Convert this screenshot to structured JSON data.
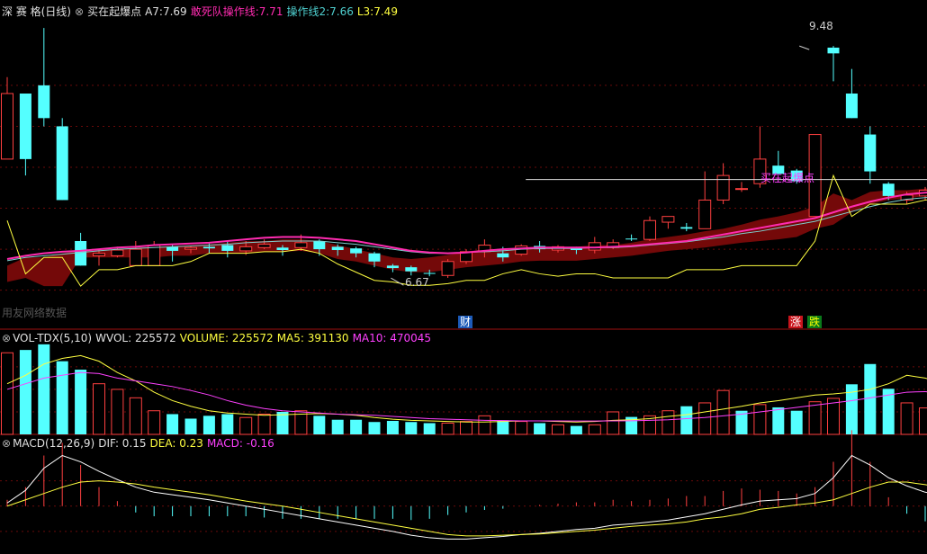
{
  "main_legend": {
    "stock": "深 赛 格(日线)",
    "sep_icon": "⊗",
    "indicator": "买在起爆点",
    "a7_label": "A7:",
    "a7_value": "7.69",
    "line1_label": "敢死队操作线:",
    "line1_value": "7.71",
    "line2_label": "操作线2:",
    "line2_value": "7.66",
    "l3_label": "L3:",
    "l3_value": "7.49"
  },
  "vol_legend": {
    "name": "VOL-TDX(5,10)",
    "wvol": "WVOL: 225572",
    "volume": "VOLUME: 225572",
    "ma5": "MA5: 391130",
    "ma10": "MA10: 470045"
  },
  "macd_legend": {
    "name": "MACD(12,26,9)",
    "dif": "DIF: 0.15",
    "dea": "DEA: 0.23",
    "macd": "MACD: -0.16"
  },
  "annotations": {
    "high_label": "9.48",
    "low_label": "6.67",
    "signal_label": "买在起爆点",
    "event_cai": "财",
    "event_zhang": "涨",
    "event_die": "跌",
    "faded_text": "用友网络数据"
  },
  "colors": {
    "up": "#ff4040",
    "down": "#54ffff",
    "band": "#7a0a0a",
    "yellow": "#ffff40",
    "magenta": "#ff2bb0",
    "ma_line": "#7fd0d0",
    "white": "#ffffff"
  },
  "chart_data": [
    {
      "type": "candlestick",
      "ylim": [
        6.2,
        9.8
      ],
      "signal_level": 7.85,
      "candles": [
        [
          8.1,
          8.9,
          8.1,
          9.1
        ],
        [
          8.9,
          8.1,
          7.9,
          8.9
        ],
        [
          9.0,
          8.6,
          8.5,
          9.7
        ],
        [
          8.5,
          7.6,
          7.6,
          8.6
        ],
        [
          7.1,
          6.8,
          6.8,
          7.2
        ],
        [
          6.92,
          6.95,
          6.8,
          7.0
        ],
        [
          6.92,
          6.99,
          6.9,
          7.03
        ],
        [
          6.8,
          7.0,
          6.8,
          7.1
        ],
        [
          6.8,
          7.05,
          6.85,
          7.1
        ],
        [
          7.03,
          6.98,
          6.85,
          7.05
        ],
        [
          7.0,
          7.02,
          6.95,
          7.04
        ],
        [
          7.03,
          7.01,
          6.95,
          7.08
        ],
        [
          7.05,
          6.98,
          6.9,
          7.1
        ],
        [
          6.98,
          7.03,
          6.93,
          7.1
        ],
        [
          7.02,
          7.06,
          7.0,
          7.12
        ],
        [
          7.02,
          6.99,
          6.92,
          7.05
        ],
        [
          7.02,
          7.08,
          6.98,
          7.18
        ],
        [
          7.1,
          7.0,
          6.92,
          7.12
        ],
        [
          7.03,
          6.99,
          6.92,
          7.06
        ],
        [
          7.01,
          6.95,
          6.9,
          7.03
        ],
        [
          6.95,
          6.85,
          6.78,
          6.97
        ],
        [
          6.8,
          6.77,
          6.72,
          6.82
        ],
        [
          6.78,
          6.73,
          6.68,
          6.8
        ],
        [
          6.71,
          6.7,
          6.67,
          6.75
        ],
        [
          6.68,
          6.85,
          6.65,
          6.88
        ],
        [
          6.85,
          6.97,
          6.82,
          7.0
        ],
        [
          6.97,
          7.05,
          6.9,
          7.12
        ],
        [
          6.95,
          6.9,
          6.85,
          7.03
        ],
        [
          6.94,
          7.04,
          6.92,
          7.06
        ],
        [
          7.04,
          7.0,
          6.96,
          7.1
        ],
        [
          6.99,
          7.03,
          6.96,
          7.05
        ],
        [
          7.01,
          6.99,
          6.94,
          7.03
        ],
        [
          6.99,
          7.08,
          6.95,
          7.15
        ],
        [
          7.02,
          7.08,
          7.0,
          7.12
        ],
        [
          7.13,
          7.12,
          7.1,
          7.18
        ],
        [
          7.12,
          7.35,
          7.1,
          7.4
        ],
        [
          7.33,
          7.4,
          7.25,
          7.4
        ],
        [
          7.27,
          7.25,
          7.22,
          7.32
        ],
        [
          7.25,
          7.6,
          7.25,
          7.95
        ],
        [
          7.6,
          7.9,
          7.55,
          8.05
        ],
        [
          7.74,
          7.74,
          7.7,
          7.82
        ],
        [
          7.8,
          8.1,
          7.75,
          8.5
        ],
        [
          8.02,
          7.92,
          7.92,
          8.2
        ],
        [
          7.96,
          7.83,
          7.8,
          7.98
        ],
        [
          7.4,
          8.4,
          7.4,
          8.4
        ],
        [
          9.46,
          9.39,
          9.05,
          9.48
        ],
        [
          8.9,
          8.6,
          8.6,
          9.2
        ],
        [
          8.4,
          7.95,
          7.8,
          8.5
        ],
        [
          7.8,
          7.65,
          7.6,
          7.82
        ],
        [
          7.6,
          7.66,
          7.55,
          7.7
        ],
        [
          7.65,
          7.72,
          7.6,
          7.76
        ],
        [
          7.7,
          7.74,
          7.65,
          7.79
        ],
        [
          7.7,
          7.71,
          7.67,
          7.75
        ]
      ],
      "a7_line": [
        7.35,
        6.7,
        6.9,
        6.9,
        6.55,
        6.75,
        6.75,
        6.8,
        6.8,
        6.8,
        6.85,
        6.95,
        6.95,
        6.95,
        6.97,
        6.97,
        7.0,
        6.95,
        6.82,
        6.72,
        6.62,
        6.6,
        6.56,
        6.56,
        6.58,
        6.62,
        6.62,
        6.7,
        6.75,
        6.7,
        6.67,
        6.7,
        6.7,
        6.65,
        6.65,
        6.65,
        6.65,
        6.75,
        6.75,
        6.75,
        6.8,
        6.8,
        6.8,
        6.8,
        7.1,
        7.9,
        7.4,
        7.55,
        7.55,
        7.55,
        7.6,
        7.62,
        7.6
      ],
      "band_top": [
        6.8,
        6.9,
        6.9,
        6.95,
        6.98,
        7.0,
        7.0,
        7.02,
        7.03,
        7.04,
        7.05,
        7.06,
        7.08,
        7.1,
        7.1,
        7.12,
        7.12,
        7.1,
        7.05,
        7.0,
        6.95,
        6.9,
        6.88,
        6.9,
        6.93,
        6.97,
        7.0,
        7.0,
        7.02,
        7.03,
        7.03,
        7.03,
        7.05,
        7.05,
        7.08,
        7.12,
        7.15,
        7.18,
        7.22,
        7.25,
        7.3,
        7.36,
        7.4,
        7.45,
        7.52,
        7.68,
        7.6,
        7.7,
        7.72,
        7.72,
        7.74,
        7.76,
        7.75
      ],
      "band_bot": [
        6.6,
        6.65,
        6.55,
        6.55,
        6.9,
        6.9,
        6.9,
        6.9,
        6.9,
        6.92,
        6.92,
        6.95,
        6.95,
        6.95,
        6.97,
        6.97,
        6.98,
        6.95,
        6.88,
        6.85,
        6.8,
        6.75,
        6.72,
        6.72,
        6.75,
        6.78,
        6.8,
        6.82,
        6.85,
        6.86,
        6.86,
        6.86,
        6.88,
        6.9,
        6.92,
        6.95,
        6.98,
        7.0,
        7.02,
        7.05,
        7.08,
        7.1,
        7.12,
        7.15,
        7.25,
        7.3,
        7.45,
        7.55,
        7.6,
        7.62,
        7.65,
        7.67,
        7.68
      ],
      "magenta_line": [
        6.88,
        6.92,
        6.95,
        6.97,
        6.98,
        7.0,
        7.02,
        7.03,
        7.05,
        7.06,
        7.07,
        7.08,
        7.1,
        7.12,
        7.14,
        7.15,
        7.15,
        7.14,
        7.12,
        7.1,
        7.06,
        7.02,
        6.98,
        6.96,
        6.95,
        6.96,
        6.98,
        7.0,
        7.01,
        7.02,
        7.02,
        7.02,
        7.02,
        7.03,
        7.04,
        7.06,
        7.08,
        7.1,
        7.14,
        7.18,
        7.22,
        7.26,
        7.3,
        7.34,
        7.38,
        7.45,
        7.52,
        7.58,
        7.63,
        7.67,
        7.69,
        7.7,
        7.71
      ],
      "ma_line": [
        6.86,
        6.9,
        6.92,
        6.94,
        6.96,
        6.98,
        7.0,
        7.01,
        7.02,
        7.03,
        7.04,
        7.05,
        7.06,
        7.08,
        7.09,
        7.1,
        7.1,
        7.1,
        7.08,
        7.06,
        7.03,
        7.0,
        6.97,
        6.95,
        6.95,
        6.96,
        6.97,
        6.98,
        7.0,
        7.01,
        7.01,
        7.01,
        7.02,
        7.02,
        7.03,
        7.05,
        7.07,
        7.09,
        7.12,
        7.15,
        7.19,
        7.22,
        7.26,
        7.3,
        7.34,
        7.4,
        7.46,
        7.52,
        7.57,
        7.61,
        7.63,
        7.65,
        7.66
      ]
    },
    {
      "type": "bar",
      "ylim": [
        0,
        1550000
      ],
      "volumes": [
        1450000,
        1500000,
        1600000,
        1300000,
        1150000,
        900000,
        800000,
        650000,
        420000,
        360000,
        280000,
        330000,
        360000,
        300000,
        360000,
        400000,
        420000,
        330000,
        260000,
        260000,
        220000,
        240000,
        220000,
        200000,
        200000,
        230000,
        330000,
        250000,
        230000,
        200000,
        170000,
        150000,
        170000,
        400000,
        310000,
        330000,
        420000,
        500000,
        560000,
        780000,
        420000,
        530000,
        480000,
        420000,
        580000,
        640000,
        890000,
        1250000,
        810000,
        560000,
        470000,
        380000,
        225572
      ],
      "up": [
        true,
        false,
        false,
        false,
        false,
        true,
        true,
        true,
        true,
        false,
        false,
        false,
        false,
        true,
        true,
        false,
        true,
        false,
        false,
        false,
        false,
        false,
        false,
        false,
        true,
        true,
        true,
        false,
        true,
        false,
        true,
        false,
        true,
        true,
        false,
        true,
        true,
        false,
        true,
        true,
        false,
        true,
        false,
        false,
        true,
        true,
        false,
        false,
        false,
        true,
        true,
        true,
        true
      ],
      "ma5": [
        900000,
        1050000,
        1250000,
        1350000,
        1400000,
        1300000,
        1100000,
        950000,
        750000,
        600000,
        500000,
        420000,
        380000,
        360000,
        340000,
        350000,
        360000,
        370000,
        360000,
        340000,
        300000,
        270000,
        250000,
        240000,
        230000,
        220000,
        220000,
        230000,
        240000,
        240000,
        230000,
        220000,
        230000,
        250000,
        260000,
        280000,
        320000,
        350000,
        400000,
        450000,
        500000,
        560000,
        600000,
        650000,
        700000,
        720000,
        750000,
        800000,
        900000,
        1050000,
        1000000,
        900000,
        700000
      ],
      "ma10": [
        800000,
        900000,
        1000000,
        1050000,
        1100000,
        1080000,
        1000000,
        950000,
        900000,
        850000,
        780000,
        700000,
        600000,
        520000,
        460000,
        420000,
        400000,
        380000,
        360000,
        350000,
        340000,
        320000,
        300000,
        280000,
        270000,
        260000,
        250000,
        245000,
        240000,
        240000,
        240000,
        238000,
        238000,
        240000,
        242000,
        250000,
        260000,
        280000,
        300000,
        330000,
        360000,
        400000,
        440000,
        480000,
        520000,
        560000,
        600000,
        650000,
        700000,
        750000,
        760000,
        720000,
        600000
      ]
    },
    {
      "type": "line",
      "ylim": [
        -0.7,
        0.85
      ],
      "dif": [
        0.05,
        0.25,
        0.6,
        0.8,
        0.7,
        0.55,
        0.42,
        0.3,
        0.22,
        0.18,
        0.14,
        0.1,
        0.05,
        0.0,
        -0.05,
        -0.1,
        -0.15,
        -0.2,
        -0.25,
        -0.3,
        -0.35,
        -0.4,
        -0.46,
        -0.5,
        -0.52,
        -0.52,
        -0.5,
        -0.48,
        -0.45,
        -0.43,
        -0.4,
        -0.37,
        -0.35,
        -0.3,
        -0.28,
        -0.25,
        -0.22,
        -0.17,
        -0.12,
        -0.05,
        0.02,
        0.08,
        0.1,
        0.12,
        0.2,
        0.45,
        0.8,
        0.65,
        0.45,
        0.32,
        0.22,
        0.18,
        0.15
      ],
      "dea": [
        0.0,
        0.1,
        0.2,
        0.3,
        0.38,
        0.4,
        0.38,
        0.35,
        0.3,
        0.26,
        0.22,
        0.18,
        0.13,
        0.08,
        0.04,
        0.0,
        -0.05,
        -0.1,
        -0.15,
        -0.2,
        -0.25,
        -0.3,
        -0.35,
        -0.4,
        -0.45,
        -0.47,
        -0.47,
        -0.46,
        -0.45,
        -0.44,
        -0.42,
        -0.4,
        -0.38,
        -0.35,
        -0.32,
        -0.3,
        -0.28,
        -0.25,
        -0.2,
        -0.17,
        -0.12,
        -0.05,
        -0.02,
        0.02,
        0.05,
        0.1,
        0.2,
        0.3,
        0.38,
        0.38,
        0.34,
        0.28,
        0.23
      ],
      "macd": [
        0.1,
        0.3,
        0.8,
        1.0,
        0.65,
        0.3,
        0.08,
        -0.1,
        -0.16,
        -0.16,
        -0.16,
        -0.16,
        -0.16,
        -0.16,
        -0.18,
        -0.2,
        -0.2,
        -0.2,
        -0.2,
        -0.2,
        -0.2,
        -0.2,
        -0.22,
        -0.2,
        -0.14,
        -0.1,
        -0.06,
        -0.04,
        0.0,
        0.02,
        0.04,
        0.06,
        0.06,
        0.1,
        0.08,
        0.1,
        0.12,
        0.16,
        0.16,
        0.24,
        0.28,
        0.26,
        0.24,
        0.2,
        0.3,
        0.7,
        1.2,
        0.7,
        0.14,
        -0.12,
        -0.24,
        -0.2,
        -0.16
      ]
    }
  ]
}
